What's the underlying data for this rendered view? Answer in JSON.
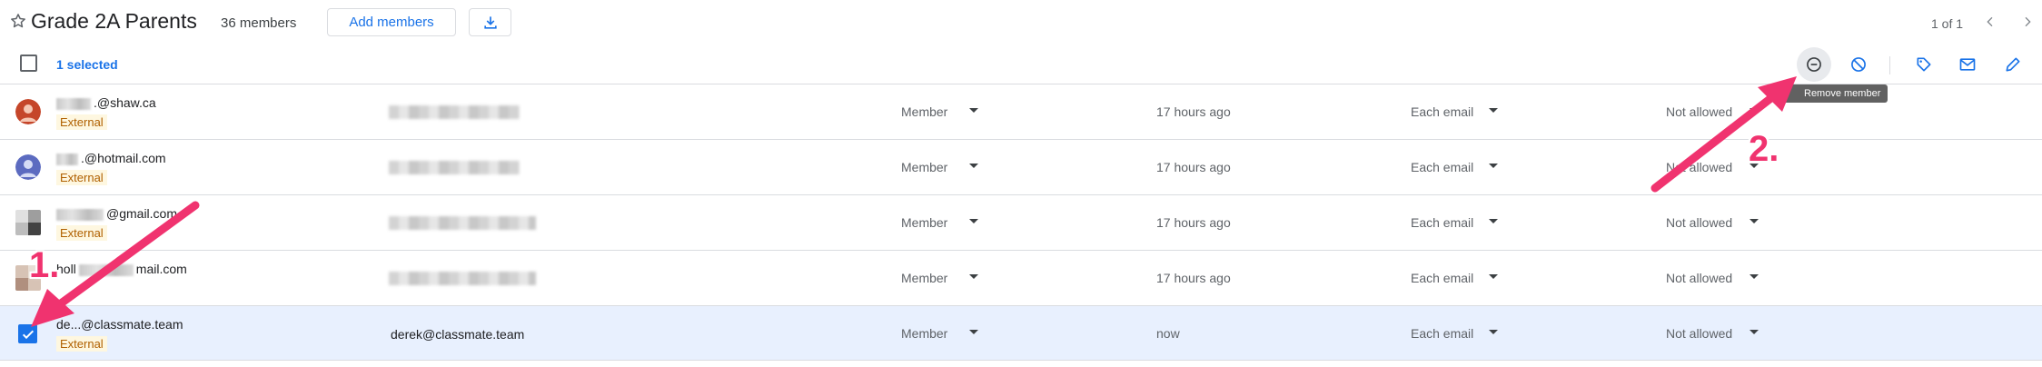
{
  "header": {
    "title": "Grade 2A Parents",
    "member_count": "36 members",
    "add_members_label": "Add members",
    "pagination": "1 of 1"
  },
  "toolbar": {
    "selected_text": "1 selected",
    "remove_tooltip": "Remove member",
    "icons": [
      "remove-member-icon",
      "block-icon",
      "label-icon",
      "email-icon",
      "edit-icon"
    ]
  },
  "rows": [
    {
      "email": ".@shaw.ca",
      "badge": "External",
      "name": "",
      "role": "Member",
      "joined": "17 hours ago",
      "delivery": "Each email",
      "posting": "Not allowed",
      "selected": false,
      "avatar_color": "#c5462a"
    },
    {
      "email": ".@hotmail.com",
      "badge": "External",
      "name": "",
      "role": "Member",
      "joined": "17 hours ago",
      "delivery": "Each email",
      "posting": "Not allowed",
      "selected": false,
      "avatar_color": "#5c6bc0"
    },
    {
      "email": "@gmail.com",
      "badge": "External",
      "name": "",
      "role": "Member",
      "joined": "17 hours ago",
      "delivery": "Each email",
      "posting": "Not allowed",
      "selected": false,
      "avatar_color": "#6d6d6d"
    },
    {
      "email_prefix": "holl",
      "email": "mail.com",
      "badge": "",
      "name": "",
      "role": "Member",
      "joined": "17 hours ago",
      "delivery": "Each email",
      "posting": "Not allowed",
      "selected": false,
      "avatar_color": "#b08f7e"
    },
    {
      "email": "de...@classmate.team",
      "badge": "External",
      "name": "derek@classmate.team",
      "role": "Member",
      "joined": "now",
      "delivery": "Each email",
      "posting": "Not allowed",
      "selected": true,
      "avatar_color": "#1a73e8"
    }
  ],
  "annotations": {
    "step1": "1.",
    "step2": "2.",
    "color": "#f0336f"
  },
  "colors": {
    "accent": "#1a73e8",
    "selected_row": "#e8f0fe",
    "badge_bg": "#fef7e0",
    "badge_text": "#b06000"
  }
}
